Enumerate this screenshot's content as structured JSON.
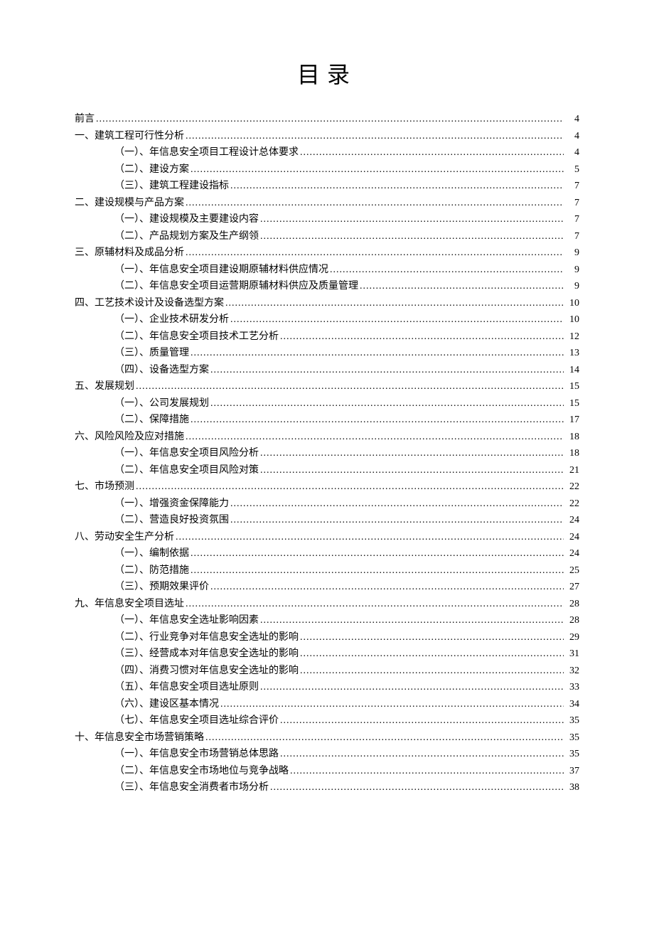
{
  "title": "目录",
  "toc": [
    {
      "level": 1,
      "label": "前言",
      "page": "4"
    },
    {
      "level": 1,
      "label": "一、建筑工程可行性分析",
      "page": "4"
    },
    {
      "level": 2,
      "label": "（一）、年信息安全项目工程设计总体要求",
      "page": "4"
    },
    {
      "level": 2,
      "label": "（二）、建设方案",
      "page": "5"
    },
    {
      "level": 2,
      "label": "（三）、建筑工程建设指标",
      "page": "7"
    },
    {
      "level": 1,
      "label": "二、建设规模与产品方案",
      "page": "7"
    },
    {
      "level": 2,
      "label": "（一）、建设规模及主要建设内容",
      "page": "7"
    },
    {
      "level": 2,
      "label": "（二）、产品规划方案及生产纲领",
      "page": "7"
    },
    {
      "level": 1,
      "label": "三、原辅材料及成品分析",
      "page": "9"
    },
    {
      "level": 2,
      "label": "（一）、年信息安全项目建设期原辅材料供应情况",
      "page": "9"
    },
    {
      "level": 2,
      "label": "（二）、年信息安全项目运营期原辅材料供应及质量管理",
      "page": "9"
    },
    {
      "level": 1,
      "label": "四、工艺技术设计及设备选型方案",
      "page": "10"
    },
    {
      "level": 2,
      "label": "（一）、企业技术研发分析",
      "page": "10"
    },
    {
      "level": 2,
      "label": "（二）、年信息安全项目技术工艺分析",
      "page": "12"
    },
    {
      "level": 2,
      "label": "（三）、质量管理",
      "page": "13"
    },
    {
      "level": 2,
      "label": "（四）、设备选型方案",
      "page": "14"
    },
    {
      "level": 1,
      "label": "五、发展规划",
      "page": "15"
    },
    {
      "level": 2,
      "label": "（一）、公司发展规划",
      "page": "15"
    },
    {
      "level": 2,
      "label": "（二）、保障措施",
      "page": "17"
    },
    {
      "level": 1,
      "label": "六、风险风险及应对措施",
      "page": "18"
    },
    {
      "level": 2,
      "label": "（一）、年信息安全项目风险分析",
      "page": "18"
    },
    {
      "level": 2,
      "label": "（二）、年信息安全项目风险对策",
      "page": "21"
    },
    {
      "level": 1,
      "label": "七、市场预测",
      "page": "22"
    },
    {
      "level": 2,
      "label": "（一）、增强资金保障能力",
      "page": "22"
    },
    {
      "level": 2,
      "label": "（二）、营造良好投资氛围",
      "page": "24"
    },
    {
      "level": 1,
      "label": "八、劳动安全生产分析",
      "page": "24"
    },
    {
      "level": 2,
      "label": "（一）、编制依据",
      "page": "24"
    },
    {
      "level": 2,
      "label": "（二）、防范措施",
      "page": "25"
    },
    {
      "level": 2,
      "label": "（三）、预期效果评价",
      "page": "27"
    },
    {
      "level": 1,
      "label": "九、年信息安全项目选址",
      "page": "28"
    },
    {
      "level": 2,
      "label": "（一）、年信息安全选址影响因素",
      "page": "28"
    },
    {
      "level": 2,
      "label": "（二）、行业竞争对年信息安全选址的影响",
      "page": "29"
    },
    {
      "level": 2,
      "label": "（三）、经营成本对年信息安全选址的影响",
      "page": "31"
    },
    {
      "level": 2,
      "label": "（四）、消费习惯对年信息安全选址的影响",
      "page": "32"
    },
    {
      "level": 2,
      "label": "（五）、年信息安全项目选址原则",
      "page": "33"
    },
    {
      "level": 2,
      "label": "（六）、建设区基本情况",
      "page": "34"
    },
    {
      "level": 2,
      "label": "（七）、年信息安全项目选址综合评价",
      "page": "35"
    },
    {
      "level": 1,
      "label": "十、年信息安全市场营销策略",
      "page": "35"
    },
    {
      "level": 2,
      "label": "（一）、年信息安全市场营销总体思路",
      "page": "35"
    },
    {
      "level": 2,
      "label": "（二）、年信息安全市场地位与竞争战略",
      "page": "37"
    },
    {
      "level": 2,
      "label": "（三）、年信息安全消费者市场分析",
      "page": "38"
    }
  ]
}
